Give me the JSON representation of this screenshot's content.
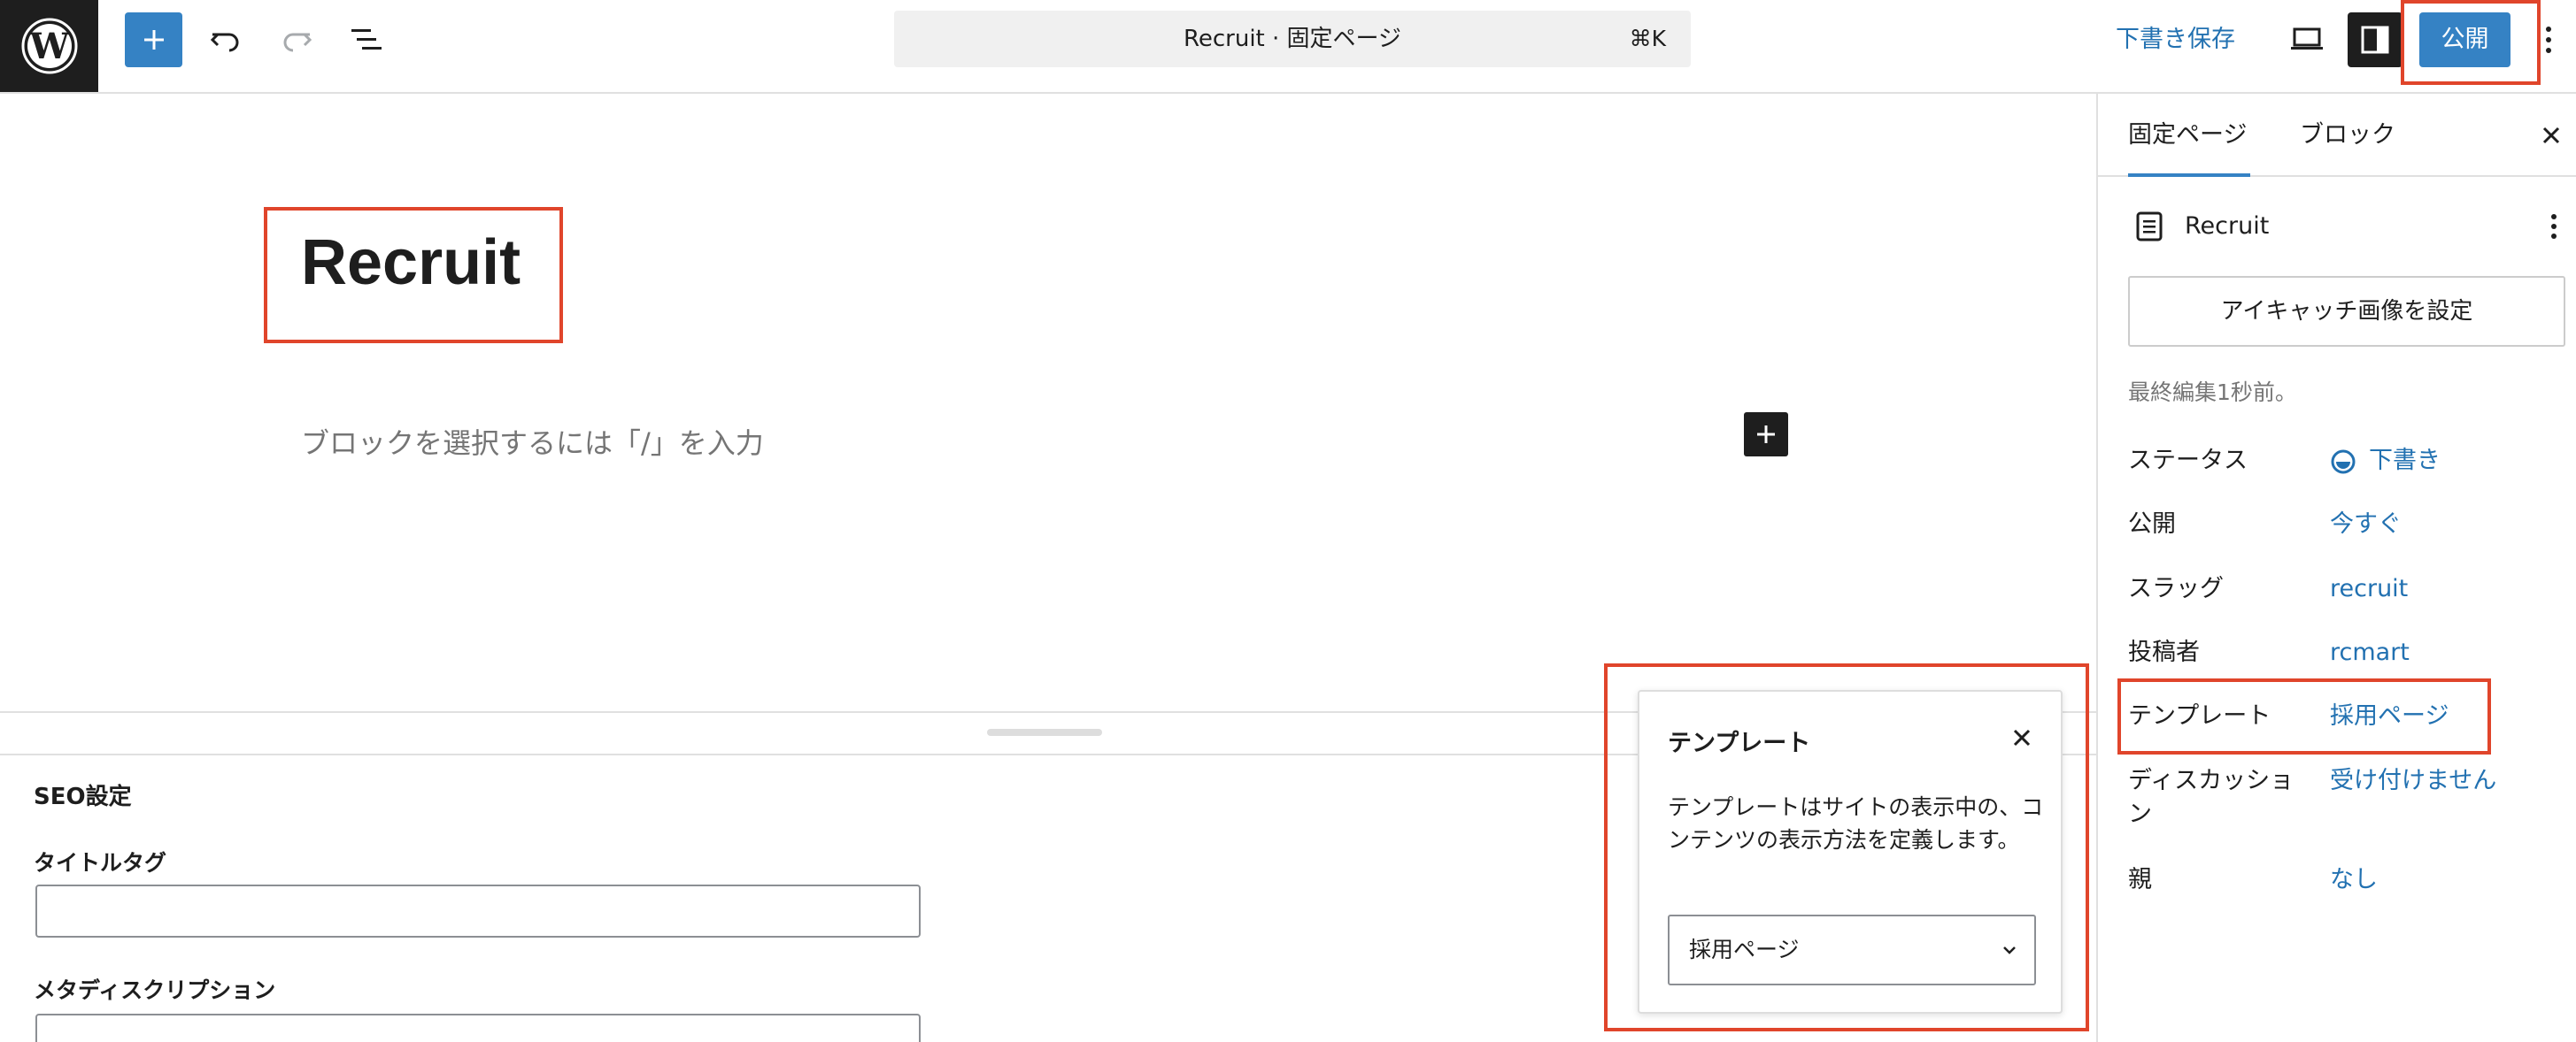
{
  "topbar": {
    "command_title": "Recruit · 固定ページ",
    "command_shortcut": "⌘K",
    "save_draft_label": "下書き保存",
    "publish_label": "公開"
  },
  "editor": {
    "post_title": "Recruit",
    "block_placeholder": "ブロックを選択するには「/」を入力"
  },
  "meta": {
    "seo_heading": "SEO設定",
    "title_tag_label": "タイトルタグ",
    "title_tag_value": "",
    "meta_description_label": "メタディスクリプション",
    "meta_description_value": ""
  },
  "template_popover": {
    "title": "テンプレート",
    "description": "テンプレートはサイトの表示中の、コンテンツの表示方法を定義します。",
    "selected": "採用ページ"
  },
  "sidebar": {
    "tabs": [
      {
        "label": "固定ページ",
        "active": true
      },
      {
        "label": "ブロック",
        "active": false
      }
    ],
    "page_name": "Recruit",
    "featured_image_button": "アイキャッチ画像を設定",
    "last_edited": "最終編集1秒前。",
    "rows": [
      {
        "label": "ステータス",
        "value": "下書き"
      },
      {
        "label": "公開",
        "value": "今すぐ"
      },
      {
        "label": "スラッグ",
        "value": "recruit"
      },
      {
        "label": "投稿者",
        "value": "rcmart"
      },
      {
        "label": "テンプレート",
        "value": "採用ページ"
      },
      {
        "label": "ディスカッション",
        "value": "受け付けません"
      },
      {
        "label": "親",
        "value": "なし"
      }
    ]
  },
  "colors": {
    "accent": "#3582c4",
    "link": "#2271b1",
    "highlight": "#e0452b"
  }
}
